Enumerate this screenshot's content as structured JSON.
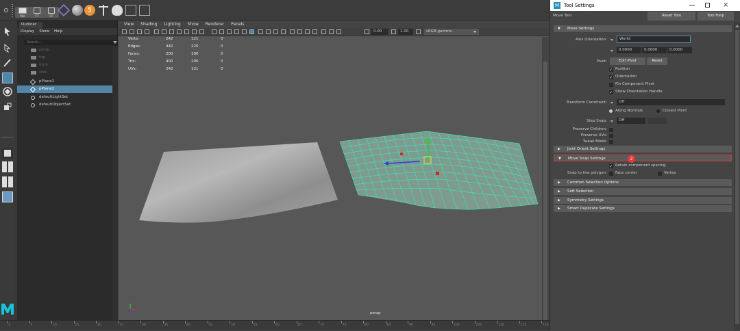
{
  "shelf": {
    "items": [
      {
        "label": "Mel",
        "icon": "mel-script-icon"
      },
      {
        "label": "FT",
        "icon": "ft-shelf-icon"
      },
      {
        "label": "CP",
        "icon": "cp-shelf-icon"
      }
    ]
  },
  "outliner": {
    "tab": "Outliner",
    "menus": [
      "Display",
      "Show",
      "Help"
    ],
    "search_placeholder": "Search...",
    "items": [
      {
        "label": "persp",
        "state": "dim"
      },
      {
        "label": "top",
        "state": "dim"
      },
      {
        "label": "front",
        "state": "dim"
      },
      {
        "label": "side",
        "state": "dim"
      },
      {
        "label": "pPlane1",
        "state": "normal"
      },
      {
        "label": "pPlane2",
        "state": "selected"
      },
      {
        "label": "defaultLightSet",
        "state": "normal"
      },
      {
        "label": "defaultObjectSet",
        "state": "normal"
      }
    ]
  },
  "viewport": {
    "menus": [
      "View",
      "Shading",
      "Lighting",
      "Show",
      "Renderer",
      "Panels"
    ],
    "field1": "0.00",
    "field2": "1.00",
    "color_space": "sRGB gamma",
    "camera_label": "persp",
    "hud": {
      "rows": [
        {
          "label": "Verts:",
          "a": "242",
          "b": "121",
          "c": "0"
        },
        {
          "label": "Edges:",
          "a": "440",
          "b": "220",
          "c": "0"
        },
        {
          "label": "Faces:",
          "a": "200",
          "b": "100",
          "c": "0"
        },
        {
          "label": "Tris:",
          "a": "400",
          "b": "200",
          "c": "0"
        },
        {
          "label": "UVs:",
          "a": "242",
          "b": "121",
          "c": "0"
        }
      ]
    }
  },
  "timeline": {
    "ticks": [
      "1",
      "5",
      "10",
      "15",
      "20",
      "25",
      "30",
      "35",
      "40",
      "45",
      "50",
      "55",
      "60",
      "65",
      "70",
      "75",
      "80",
      "85",
      "90",
      "95",
      "100",
      "105",
      "110",
      "115",
      "120"
    ]
  },
  "tool_settings": {
    "window_title": "Tool Settings",
    "tool_name": "Move Tool",
    "reset_button": "Reset Tool",
    "help_button": "Tool Help",
    "sections": {
      "move_settings": "Move Settings",
      "joint_orient": "Joint Orient Settings",
      "move_snap": "Move Snap Settings",
      "common_selection": "Common Selection Options",
      "soft_selection": "Soft Selection",
      "symmetry": "Symmetry Settings",
      "smart_duplicate": "Smart Duplicate Settings"
    },
    "axis_orientation_label": "Axis Orientation:",
    "axis_orientation_value": "World",
    "vector": [
      "0.0000",
      "0.0000",
      "0.0000"
    ],
    "pivot_label": "Pivot:",
    "edit_pivot": "Edit Pivot",
    "reset": "Reset",
    "pivot_options": [
      "Position",
      "Orientation",
      "Pin Component Pivot",
      "Show Orientation Handle"
    ],
    "transform_constraint_label": "Transform Constraint:",
    "transform_constraint_value": "Off",
    "along_normals": "Along Normals",
    "closest_point": "Closest Point",
    "step_snap_label": "Step Snap:",
    "step_snap_value": "Off",
    "preserve_children": "Preserve Children:",
    "preserve_uvs": "Preserve UVs:",
    "tweak_mode": "Tweak Mode:",
    "retain_spacing": "Retain component spacing",
    "snap_to_live": "Snap to live polygon:",
    "face_center": "Face center",
    "vertex": "Vertex"
  },
  "markers": {
    "m1": "1",
    "m2": "2"
  },
  "colors": {
    "accent": "#5285a6",
    "wire": "#3fe0b0",
    "marker": "#e03a3a"
  }
}
